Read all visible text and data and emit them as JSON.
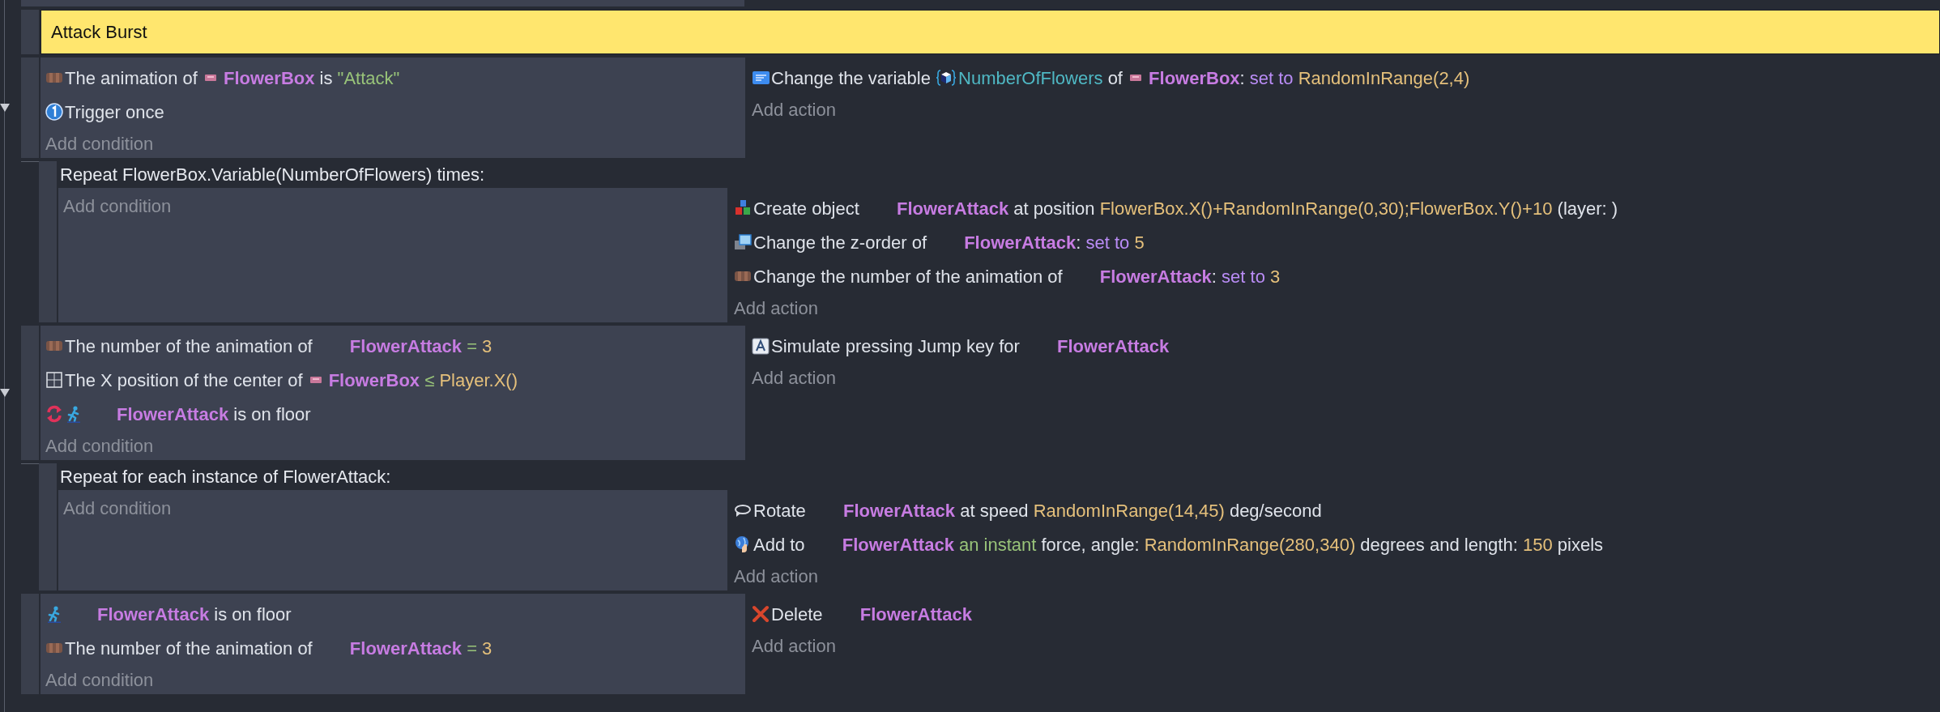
{
  "events": [
    {
      "kind": "comment",
      "text": "Attack Burst"
    },
    {
      "kind": "standard",
      "expanded": true,
      "add_condition": "Add condition",
      "add_action": "Add action",
      "conditions": [
        {
          "kind": "animation",
          "inverted": false,
          "parts": [
            {
              "kind": "text",
              "text": "The animation of "
            },
            {
              "kind": "boxobject",
              "text": "FlowerBox"
            },
            {
              "kind": "text",
              "text": " is "
            },
            {
              "kind": "string",
              "text": "\"Attack\""
            }
          ]
        },
        {
          "kind": "trigger",
          "inverted": false,
          "parts": [
            {
              "kind": "text",
              "text": "Trigger once"
            }
          ]
        }
      ],
      "actions": [
        {
          "kind": "variable",
          "parts": [
            {
              "kind": "text",
              "text": "Change the variable "
            },
            {
              "kind": "variable",
              "text": "NumberOfFlowers"
            },
            {
              "kind": "text",
              "text": " of "
            },
            {
              "kind": "boxobject",
              "text": "FlowerBox"
            },
            {
              "kind": "text",
              "text": ": "
            },
            {
              "kind": "setto",
              "text": "set to "
            },
            {
              "kind": "expr",
              "text": "RandomInRange(2,4)"
            }
          ]
        }
      ],
      "children": [
        {
          "header": "Repeat FlowerBox.Variable(NumberOfFlowers) times:",
          "add_condition": "Add condition",
          "add_action": "Add action",
          "actions": [
            {
              "kind": "create",
              "parts": [
                {
                  "kind": "text",
                  "text": "Create object "
                },
                {
                  "kind": "object",
                  "text": "FlowerAttack"
                },
                {
                  "kind": "text",
                  "text": " at position "
                },
                {
                  "kind": "expr",
                  "text": "FlowerBox.X()+RandomInRange(0,30);FlowerBox.Y()+10"
                },
                {
                  "kind": "text",
                  "text": " (layer: )"
                }
              ]
            },
            {
              "kind": "zorder",
              "parts": [
                {
                  "kind": "text",
                  "text": "Change the z-order of "
                },
                {
                  "kind": "object",
                  "text": "FlowerAttack"
                },
                {
                  "kind": "text",
                  "text": ": "
                },
                {
                  "kind": "setto",
                  "text": "set to "
                },
                {
                  "kind": "expr",
                  "text": "5"
                }
              ]
            },
            {
              "kind": "animation",
              "parts": [
                {
                  "kind": "text",
                  "text": "Change the number of the animation of "
                },
                {
                  "kind": "object",
                  "text": "FlowerAttack"
                },
                {
                  "kind": "text",
                  "text": ": "
                },
                {
                  "kind": "setto",
                  "text": "set to "
                },
                {
                  "kind": "expr",
                  "text": "3"
                }
              ]
            }
          ]
        }
      ]
    },
    {
      "kind": "standard",
      "expanded": true,
      "add_condition": "Add condition",
      "add_action": "Add action",
      "conditions": [
        {
          "kind": "animation",
          "inverted": false,
          "parts": [
            {
              "kind": "text",
              "text": "The number of the animation of "
            },
            {
              "kind": "object",
              "text": "FlowerAttack"
            },
            {
              "kind": "op",
              "text": " = "
            },
            {
              "kind": "expr",
              "text": "3"
            }
          ]
        },
        {
          "kind": "position",
          "inverted": false,
          "parts": [
            {
              "kind": "text",
              "text": "The X position of the center of "
            },
            {
              "kind": "boxobject",
              "text": "FlowerBox"
            },
            {
              "kind": "op",
              "text": " ≤ "
            },
            {
              "kind": "expr",
              "text": "Player.X()"
            }
          ]
        },
        {
          "kind": "platformer",
          "inverted": true,
          "parts": [
            {
              "kind": "object",
              "text": "FlowerAttack"
            },
            {
              "kind": "text",
              "text": " is on floor"
            }
          ]
        }
      ],
      "actions": [
        {
          "kind": "keypress",
          "parts": [
            {
              "kind": "text",
              "text": "Simulate pressing Jump key for "
            },
            {
              "kind": "object",
              "text": "FlowerAttack"
            }
          ]
        }
      ],
      "children": [
        {
          "header": "Repeat for each instance of FlowerAttack:",
          "add_condition": "Add condition",
          "add_action": "Add action",
          "actions": [
            {
              "kind": "rotate",
              "parts": [
                {
                  "kind": "text",
                  "text": "Rotate "
                },
                {
                  "kind": "object",
                  "text": "FlowerAttack"
                },
                {
                  "kind": "text",
                  "text": " at speed "
                },
                {
                  "kind": "expr",
                  "text": "RandomInRange(14,45)"
                },
                {
                  "kind": "text",
                  "text": " deg/second"
                }
              ]
            },
            {
              "kind": "force",
              "parts": [
                {
                  "kind": "text",
                  "text": "Add to "
                },
                {
                  "kind": "object",
                  "text": "FlowerAttack"
                },
                {
                  "kind": "string",
                  "text": " an instant"
                },
                {
                  "kind": "text",
                  "text": " force, angle: "
                },
                {
                  "kind": "expr",
                  "text": "RandomInRange(280,340)"
                },
                {
                  "kind": "text",
                  "text": " degrees and length: "
                },
                {
                  "kind": "expr",
                  "text": "150"
                },
                {
                  "kind": "text",
                  "text": " pixels"
                }
              ]
            }
          ]
        }
      ]
    },
    {
      "kind": "standard",
      "expanded": false,
      "add_condition": "Add condition",
      "add_action": "Add action",
      "conditions": [
        {
          "kind": "platformer",
          "inverted": false,
          "parts": [
            {
              "kind": "object",
              "text": "FlowerAttack"
            },
            {
              "kind": "text",
              "text": " is on floor"
            }
          ]
        },
        {
          "kind": "animation",
          "inverted": false,
          "parts": [
            {
              "kind": "text",
              "text": "The number of the animation of "
            },
            {
              "kind": "object",
              "text": "FlowerAttack"
            },
            {
              "kind": "op",
              "text": " = "
            },
            {
              "kind": "expr",
              "text": "3"
            }
          ]
        }
      ],
      "actions": [
        {
          "kind": "delete",
          "parts": [
            {
              "kind": "text",
              "text": "Delete "
            },
            {
              "kind": "object",
              "text": "FlowerAttack"
            }
          ]
        }
      ]
    }
  ]
}
